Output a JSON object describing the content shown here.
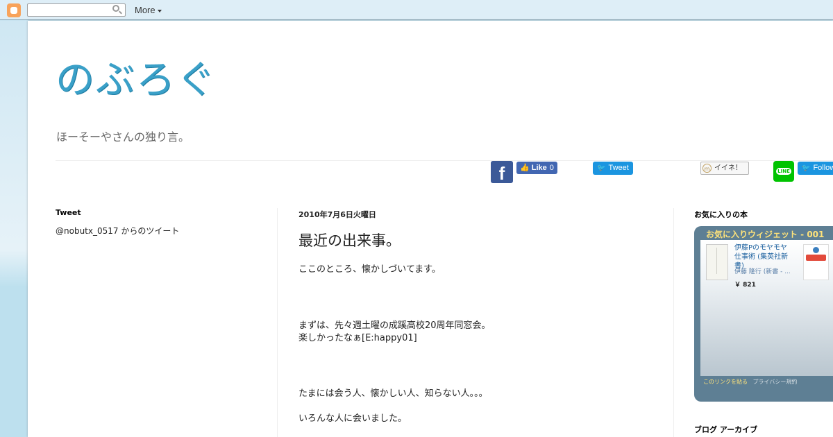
{
  "navbar": {
    "more_label": "More"
  },
  "header": {
    "blog_title": "のぶろぐ",
    "description": "ほーそーやさんの独り言。"
  },
  "social": {
    "facebook_glyph": "f",
    "like_label": "Like",
    "like_count": "0",
    "tweet_label": "Tweet",
    "mixi_label": "イイネ！",
    "line_label": "LINE",
    "follow_label": "Follow"
  },
  "left_sidebar": {
    "widget_title": "Tweet",
    "subtitle": "@nobutx_0517 からのツイート"
  },
  "post": {
    "date": "2010年7月6日火曜日",
    "title": "最近の出来事。",
    "lines": [
      "ここのところ、懐かしづいてます。",
      "まずは、先々週土曜の成蹊高校20周年同窓会。",
      "楽しかったなぁ[E:happy01]",
      "たまには会う人、懐かしい人、知らない人。。。",
      "いろんな人に会いました。"
    ]
  },
  "right_sidebar": {
    "fav_title": "お気に入りの本",
    "widget_header": "お気に入りウィジェット - 001",
    "book1": {
      "title": "伊藤Pのモヤモヤ仕事術 (集英社新書)",
      "author": "伊藤 隆行 (新書 - ...",
      "price": "￥ 821"
    },
    "book2_price": "￥",
    "link_paste": "このリンクを貼る",
    "link_privacy": "プライバシー規約",
    "archive_title": "ブログ アーカイブ"
  },
  "colors": {
    "title_blue": "#3aa0c8",
    "facebook": "#3b5998",
    "twitter": "#1b95e0",
    "line_green": "#00c300",
    "widget_bg": "#5e7f94",
    "widget_header_text": "#ffe37a"
  }
}
